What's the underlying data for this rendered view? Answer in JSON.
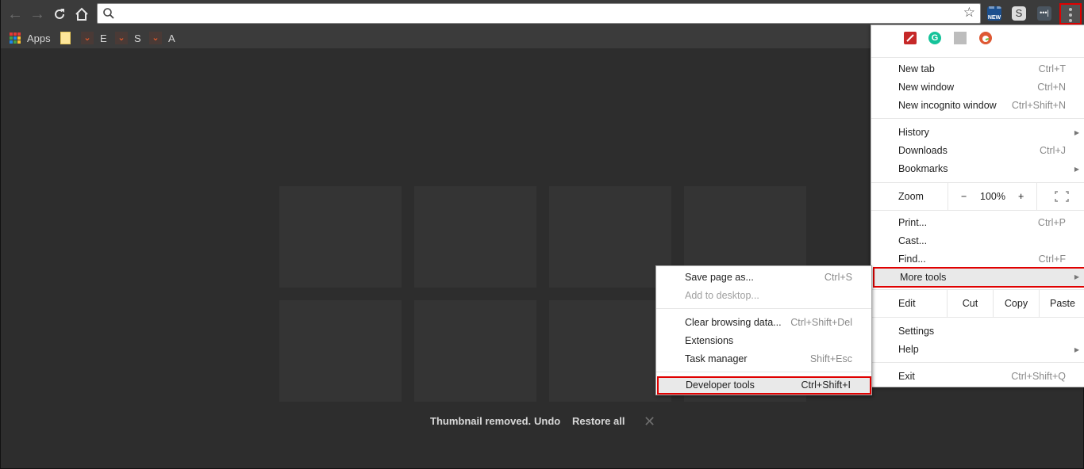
{
  "toolbar": {
    "back_icon": "arrow-left-icon",
    "forward_icon": "arrow-right-icon",
    "reload_icon": "reload-icon",
    "home_icon": "home-icon",
    "omnibox": {
      "value": "",
      "placeholder": ""
    },
    "bookmark_star_icon": "star-icon",
    "extensions": [
      {
        "name": "new-badge-extension",
        "label": "NEW"
      },
      {
        "name": "s-extension",
        "label": "S"
      },
      {
        "name": "dots-extension",
        "label": "•••|"
      }
    ],
    "menu_icon": "vertical-dots-icon"
  },
  "bookmarks": {
    "items": [
      {
        "label": "Apps",
        "icon": "apps-grid-icon"
      },
      {
        "label": "",
        "icon": "folder-icon"
      },
      {
        "label": "E",
        "icon": "chevron-bookmark-icon"
      },
      {
        "label": "S",
        "icon": "chevron-bookmark-icon"
      },
      {
        "label": "A",
        "icon": "chevron-bookmark-icon"
      }
    ]
  },
  "newtab": {
    "notice": {
      "message": "Thumbnail removed.",
      "undo": "Undo",
      "restore_all": "Restore all",
      "close_icon": "close-icon"
    }
  },
  "main_menu": {
    "extension_icons": [
      "pen-extension-icon",
      "grammarly-icon",
      "blank-extension-icon",
      "duckduckgo-icon"
    ],
    "group1": [
      {
        "label": "New tab",
        "shortcut": "Ctrl+T"
      },
      {
        "label": "New window",
        "shortcut": "Ctrl+N"
      },
      {
        "label": "New incognito window",
        "shortcut": "Ctrl+Shift+N"
      }
    ],
    "group2": [
      {
        "label": "History",
        "submenu": true
      },
      {
        "label": "Downloads",
        "shortcut": "Ctrl+J"
      },
      {
        "label": "Bookmarks",
        "submenu": true
      }
    ],
    "zoom": {
      "label": "Zoom",
      "minus": "−",
      "value": "100%",
      "plus": "+",
      "fullscreen_icon": "fullscreen-icon"
    },
    "group3": [
      {
        "label": "Print...",
        "shortcut": "Ctrl+P"
      },
      {
        "label": "Cast..."
      },
      {
        "label": "Find...",
        "shortcut": "Ctrl+F"
      },
      {
        "label": "More tools",
        "submenu": true,
        "highlighted": true
      }
    ],
    "edit": {
      "label": "Edit",
      "cut": "Cut",
      "copy": "Copy",
      "paste": "Paste"
    },
    "group4": [
      {
        "label": "Settings"
      },
      {
        "label": "Help",
        "submenu": true
      }
    ],
    "exit": {
      "label": "Exit",
      "shortcut": "Ctrl+Shift+Q"
    }
  },
  "more_tools_menu": {
    "items": [
      {
        "label": "Save page as...",
        "shortcut": "Ctrl+S"
      },
      {
        "label": "Add to desktop...",
        "disabled": true
      },
      {
        "label": "Clear browsing data...",
        "shortcut": "Ctrl+Shift+Del"
      },
      {
        "label": "Extensions"
      },
      {
        "label": "Task manager",
        "shortcut": "Shift+Esc"
      },
      {
        "label": "Developer tools",
        "shortcut": "Ctrl+Shift+I",
        "highlighted": true
      }
    ]
  },
  "colors": {
    "highlight_border": "#e00000",
    "toolbar_bg": "#3b3b3b",
    "page_bg": "#2d2d2d",
    "tile_bg": "#343434"
  }
}
